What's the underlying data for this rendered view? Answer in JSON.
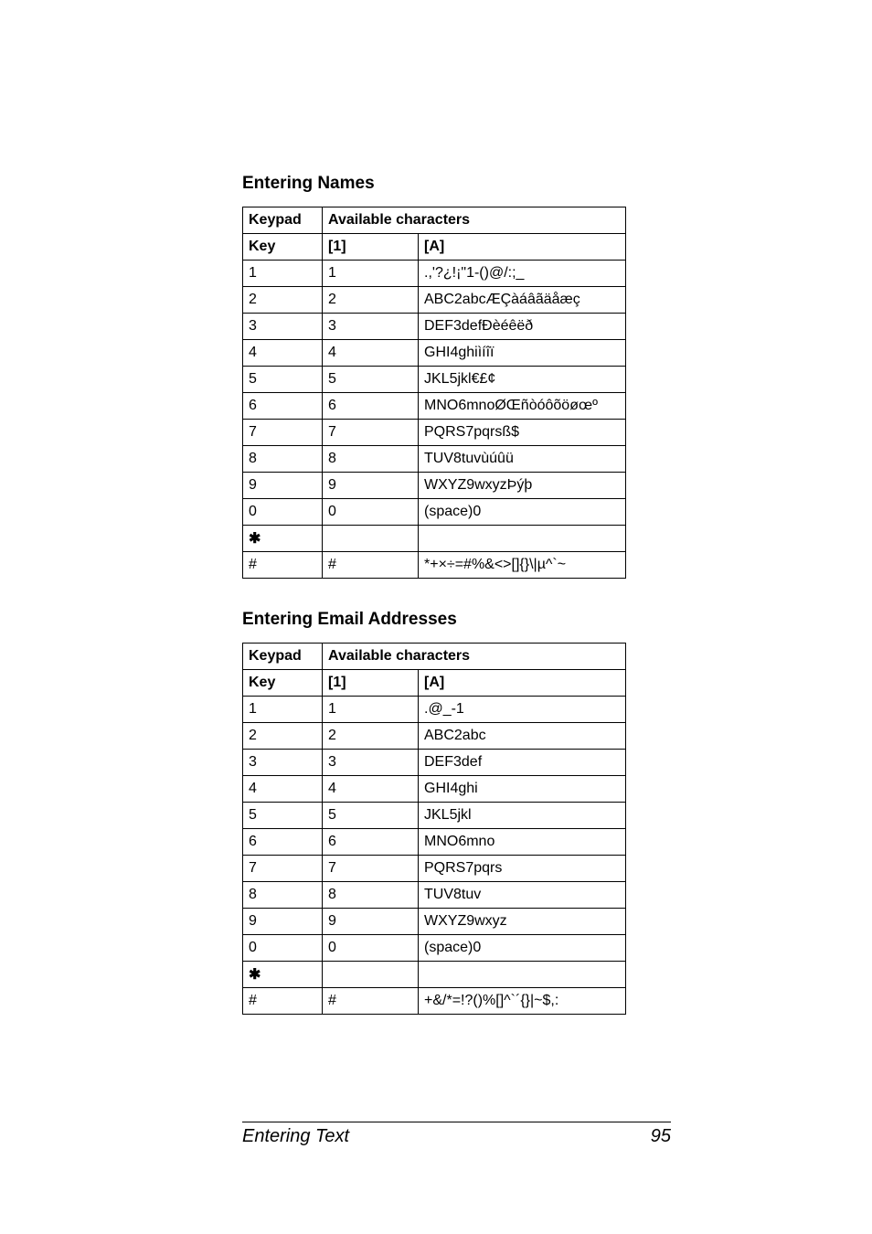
{
  "sections": [
    {
      "heading": "Entering Names",
      "header_top": [
        "Keypad",
        "Available characters"
      ],
      "header_sub": [
        "Key",
        "[1]",
        "[A]"
      ],
      "rows": [
        [
          "1",
          "1",
          ".,'?¿!¡\"1-()@/:;_"
        ],
        [
          "2",
          "2",
          "ABC2abcÆÇàáâãäåæç"
        ],
        [
          "3",
          "3",
          "DEF3defÐèéêëð"
        ],
        [
          "4",
          "4",
          "GHI4ghiìíîï"
        ],
        [
          "5",
          "5",
          "JKL5jkl€£¢"
        ],
        [
          "6",
          "6",
          "MNO6mnoØŒñòóôõöøœº"
        ],
        [
          "7",
          "7",
          "PQRS7pqrsß$"
        ],
        [
          "8",
          "8",
          "TUV8tuvùúûü"
        ],
        [
          "9",
          "9",
          "WXYZ9wxyzÞýþ"
        ],
        [
          "0",
          "0",
          "(space)0"
        ],
        [
          "✱",
          "",
          ""
        ],
        [
          "#",
          "#",
          "*+×÷=#%&<>[]{}\\|µ^`~"
        ]
      ]
    },
    {
      "heading": "Entering Email Addresses",
      "header_top": [
        "Keypad",
        "Available characters"
      ],
      "header_sub": [
        "Key",
        "[1]",
        "[A]"
      ],
      "rows": [
        [
          "1",
          "1",
          ".@_-1"
        ],
        [
          "2",
          "2",
          "ABC2abc"
        ],
        [
          "3",
          "3",
          "DEF3def"
        ],
        [
          "4",
          "4",
          "GHI4ghi"
        ],
        [
          "5",
          "5",
          "JKL5jkl"
        ],
        [
          "6",
          "6",
          "MNO6mno"
        ],
        [
          "7",
          "7",
          "PQRS7pqrs"
        ],
        [
          "8",
          "8",
          "TUV8tuv"
        ],
        [
          "9",
          "9",
          "WXYZ9wxyz"
        ],
        [
          "0",
          "0",
          "(space)0"
        ],
        [
          "✱",
          "",
          ""
        ],
        [
          "#",
          "#",
          "+&/*=!?()%[]^`´{}|~$,:"
        ]
      ]
    }
  ],
  "footer": {
    "left": "Entering Text",
    "right": "95"
  }
}
